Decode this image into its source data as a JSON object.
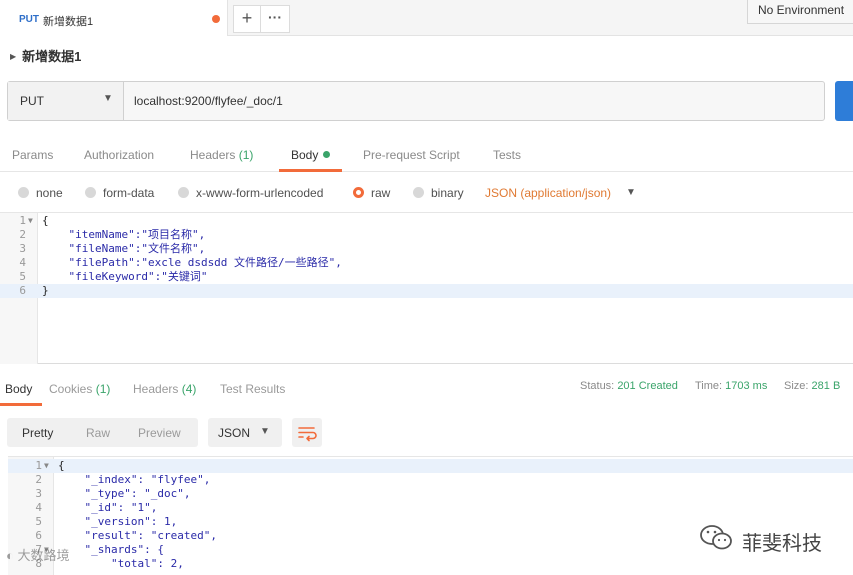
{
  "tab": {
    "method": "PUT",
    "title": "新增数据1"
  },
  "environment": {
    "label": "No Environment"
  },
  "request": {
    "name": "新增数据1",
    "method": "PUT",
    "url": "localhost:9200/flyfee/_doc/1"
  },
  "request_tabs": [
    {
      "label": "Params"
    },
    {
      "label": "Authorization"
    },
    {
      "label": "Headers",
      "count": "(1)"
    },
    {
      "label": "Body"
    },
    {
      "label": "Pre-request Script"
    },
    {
      "label": "Tests"
    }
  ],
  "body_types": [
    {
      "label": "none"
    },
    {
      "label": "form-data"
    },
    {
      "label": "x-www-form-urlencoded"
    },
    {
      "label": "raw",
      "selected": true
    },
    {
      "label": "binary"
    }
  ],
  "body_format": "JSON (application/json)",
  "request_body": [
    {
      "n": "1",
      "text": "{"
    },
    {
      "n": "2",
      "text": "    \"itemName\":\"项目名称\","
    },
    {
      "n": "3",
      "text": "    \"fileName\":\"文件名称\","
    },
    {
      "n": "4",
      "text": "    \"filePath\":\"excle dsdsdd 文件路径/一些路径\","
    },
    {
      "n": "5",
      "text": "    \"fileKeyword\":\"关键词\""
    },
    {
      "n": "6",
      "text": "}"
    }
  ],
  "response_tabs": [
    {
      "label": "Body"
    },
    {
      "label": "Cookies",
      "count": "(1)"
    },
    {
      "label": "Headers",
      "count": "(4)"
    },
    {
      "label": "Test Results"
    }
  ],
  "response_status": {
    "status_label": "Status:",
    "status_value": "201 Created",
    "time_label": "Time:",
    "time_value": "1703 ms",
    "size_label": "Size:",
    "size_value": "281 B"
  },
  "view_modes": [
    {
      "label": "Pretty"
    },
    {
      "label": "Raw"
    },
    {
      "label": "Preview"
    }
  ],
  "response_format": "JSON",
  "response_body": [
    {
      "n": "1",
      "text": "{"
    },
    {
      "n": "2",
      "text": "    \"_index\": \"flyfee\","
    },
    {
      "n": "3",
      "text": "    \"_type\": \"_doc\","
    },
    {
      "n": "4",
      "text": "    \"_id\": \"1\","
    },
    {
      "n": "5",
      "text": "    \"_version\": 1,"
    },
    {
      "n": "6",
      "text": "    \"result\": \"created\","
    },
    {
      "n": "7",
      "text": "    \"_shards\": {"
    },
    {
      "n": "8",
      "text": "        \"total\": 2,"
    }
  ],
  "watermarks": {
    "right": "菲斐科技",
    "left": "大数路境"
  },
  "colors": {
    "accent": "#f26b3a",
    "success": "#3aa46a",
    "send": "#2e7dd8"
  }
}
